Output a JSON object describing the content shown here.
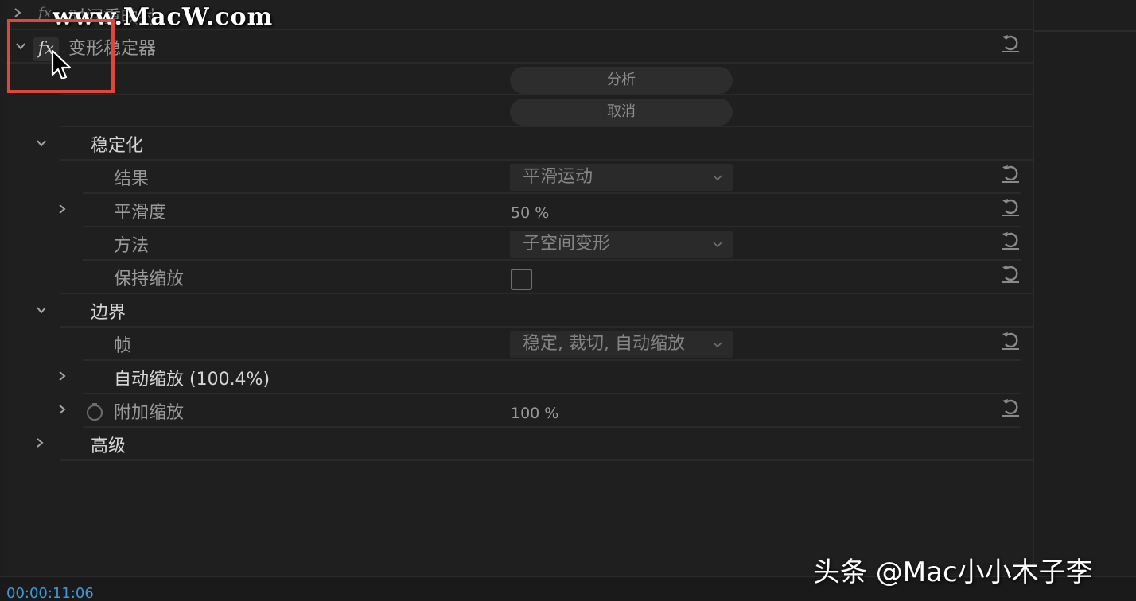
{
  "watermark": "www.MacW.com",
  "effect_above": {
    "label": "时间重映射"
  },
  "effect": {
    "fx_glyph": "fx",
    "name": "变形稳定器",
    "analyze_button": "分析",
    "cancel_button": "取消"
  },
  "stabilization": {
    "group_label": "稳定化",
    "result_label": "结果",
    "result_value": "平滑运动",
    "smoothness_label": "平滑度",
    "smoothness_value": "50 %",
    "method_label": "方法",
    "method_value": "子空间变形",
    "preserve_scale_label": "保持缩放",
    "preserve_scale_checked": false
  },
  "borders": {
    "group_label": "边界",
    "framing_label": "帧",
    "framing_value": "稳定, 裁切, 自动缩放",
    "auto_scale_label": "自动缩放 (100.4%)",
    "additional_scale_label": "附加缩放",
    "additional_scale_value": "100 %"
  },
  "advanced": {
    "group_label": "高级"
  },
  "footer": {
    "timecode": "00:00:11:06",
    "credit": "头条 @Mac小小木子李"
  },
  "colors": {
    "highlight": "#e0473b",
    "timecode": "#3a9ad9",
    "panel_bg": "#1f1f1f"
  },
  "icons": {
    "collapse": "chevron-down-icon",
    "expand": "chevron-right-icon",
    "reset": "reset-icon",
    "stopwatch": "stopwatch-icon",
    "cursor": "mouse-pointer-icon"
  }
}
